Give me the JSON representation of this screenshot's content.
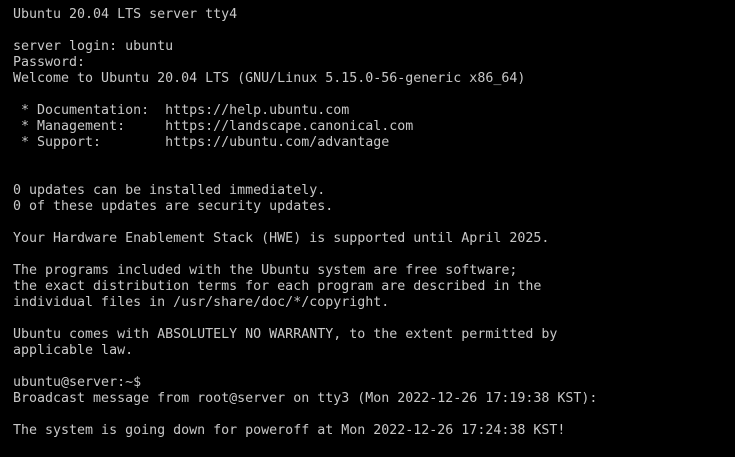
{
  "terminal": {
    "lines": [
      "Ubuntu 20.04 LTS server tty4",
      "",
      "server login: ubuntu",
      "Password:",
      "Welcome to Ubuntu 20.04 LTS (GNU/Linux 5.15.0-56-generic x86_64)",
      "",
      " * Documentation:  https://help.ubuntu.com",
      " * Management:     https://landscape.canonical.com",
      " * Support:        https://ubuntu.com/advantage",
      "",
      "",
      "0 updates can be installed immediately.",
      "0 of these updates are security updates.",
      "",
      "Your Hardware Enablement Stack (HWE) is supported until April 2025.",
      "",
      "The programs included with the Ubuntu system are free software;",
      "the exact distribution terms for each program are described in the",
      "individual files in /usr/share/doc/*/copyright.",
      "",
      "Ubuntu comes with ABSOLUTELY NO WARRANTY, to the extent permitted by",
      "applicable law.",
      "",
      "ubuntu@server:~$",
      "Broadcast message from root@server on tty3 (Mon 2022-12-26 17:19:38 KST):",
      "",
      "The system is going down for poweroff at Mon 2022-12-26 17:24:38 KST!"
    ]
  }
}
